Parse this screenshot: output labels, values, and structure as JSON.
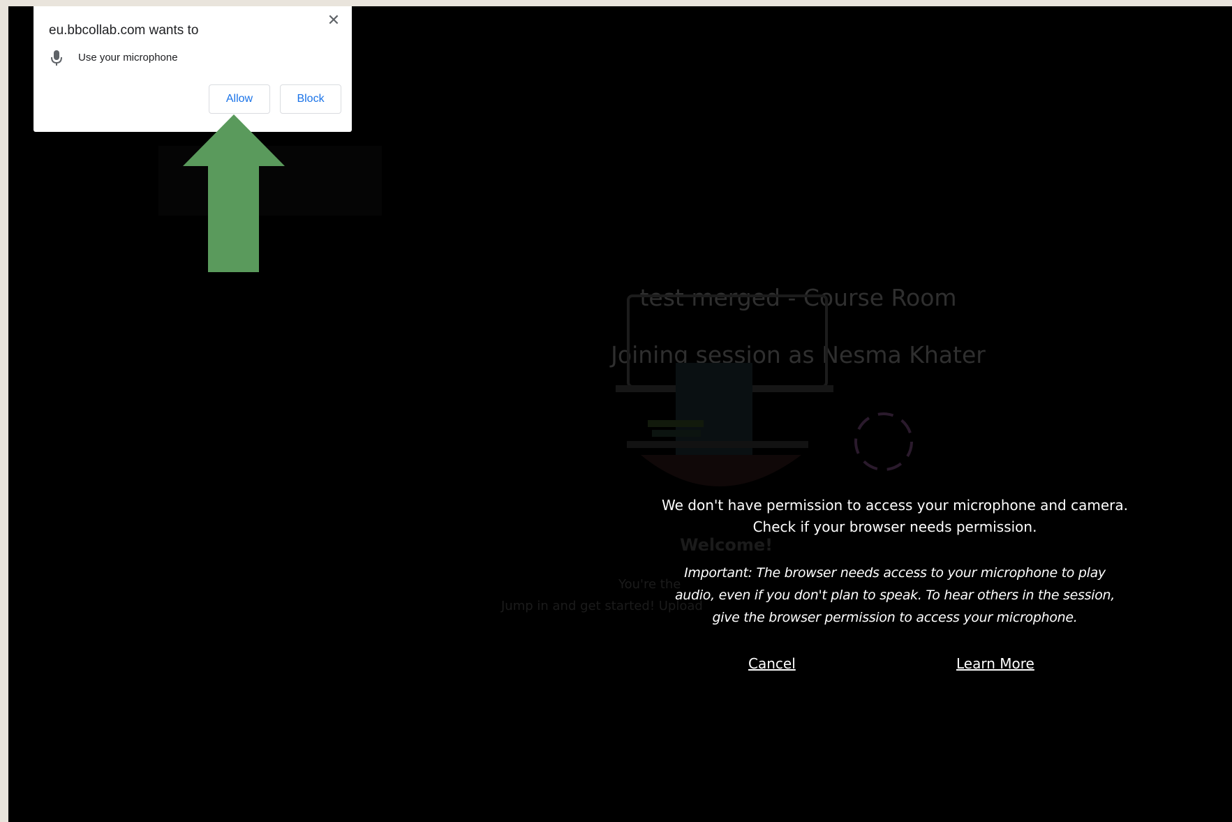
{
  "popup": {
    "title": "eu.bbcollab.com wants to",
    "permission": "Use your microphone",
    "permission_icon": "microphone-icon",
    "close_glyph": "✕",
    "allow_label": "Allow",
    "block_label": "Block"
  },
  "session": {
    "room_title": "test merged - Course Room",
    "joining": "Joining session as Nesma Khater",
    "welcome_heading": "Welcome!",
    "welcome_line1": "You're the",
    "welcome_line2": "Jump in and get started! Upload"
  },
  "message": {
    "line1": "We don't have permission to access your microphone and camera.",
    "line2": "Check if your browser needs permission.",
    "important1": "Important: The browser needs access to your microphone to play",
    "important2": "audio, even if you don't plan to speak. To hear others in the session,",
    "important3": "give the browser permission to access your microphone.",
    "cancel_label": "Cancel",
    "learn_more_label": "Learn More"
  },
  "annotation": {
    "arrow_icon": "arrow-up-icon",
    "arrow_color": "#5a9a5c"
  },
  "colors": {
    "backdrop": "#000000",
    "frame": "#e9e4dc",
    "popup_button_text": "#1a73e8"
  }
}
